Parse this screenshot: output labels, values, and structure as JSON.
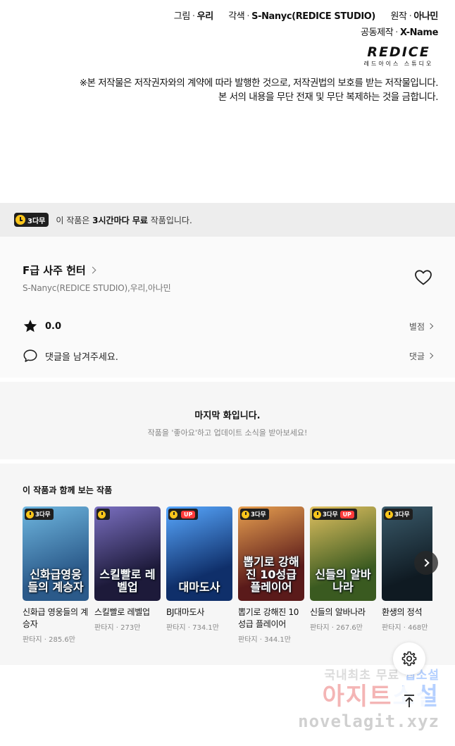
{
  "credits": {
    "art_label": "그림",
    "art_value": "우리",
    "adapt_label": "각색",
    "adapt_value": "S-Nanyc(REDICE STUDIO)",
    "original_label": "원작",
    "original_value": "아나민",
    "co_label": "공동제작",
    "co_value": "X-Name",
    "logo_word": "REDICE",
    "logo_sub": "레드아이스 스튜디오",
    "notice_line1": "※본 저작물은 저작권자와의 계약에 따라 발행한 것으로, 저작권법의 보호를 받는 저작물입니다.",
    "notice_line2": "본 서의 내용을 무단 전재 및 무단 복제하는 것을 금합니다."
  },
  "wait_banner": {
    "badge": "3다무",
    "text_pre": "이 작품은 ",
    "text_bold": "3시간마다 무료",
    "text_post": " 작품입니다."
  },
  "series": {
    "title": "F급 사주 헌터",
    "authors": "S-Nanyc(REDICE STUDIO),우리,아나민",
    "rating": "0.0",
    "rating_link": "별점",
    "comment_prompt": "댓글을 남겨주세요.",
    "comment_link": "댓글"
  },
  "last_episode": {
    "title": "마지막 화입니다.",
    "subtitle": "작품을 '좋아요'하고 업데이트 소식을 받아보세요!"
  },
  "recommendations": {
    "title": "이 작품과 함께 보는 작품",
    "items": [
      {
        "name": "신화급 영웅들의 계승자",
        "meta": "판타지 · 285.6만",
        "badge": "3다무",
        "up": "",
        "cover_text": "신화급영웅들의 계승자",
        "colors": [
          "#2b5a8a",
          "#6fb7e0"
        ]
      },
      {
        "name": "스킬빨로 레벨업",
        "meta": "판타지 · 273만",
        "badge": "",
        "up": "",
        "cover_text": "스킬빨로 레벨업",
        "colors": [
          "#1d1a3a",
          "#7a6fc0"
        ]
      },
      {
        "name": "BJ대마도사",
        "meta": "판타지 · 734.1만",
        "badge": "",
        "up": "UP",
        "cover_text": "대마도사",
        "colors": [
          "#0f2f6a",
          "#58a8ff"
        ]
      },
      {
        "name": "뽑기로 강해진 10성급 플레이어",
        "meta": "판타지 · 344.1만",
        "badge": "3다무",
        "up": "",
        "cover_text": "뽑기로 강해진 10성급 플레이어",
        "colors": [
          "#5a1a1a",
          "#e8a050"
        ]
      },
      {
        "name": "신들의 알바나라",
        "meta": "판타지 · 267.6만",
        "badge": "3다무",
        "up": "UP",
        "cover_text": "신들의 알바나라",
        "colors": [
          "#3a5a20",
          "#e0c060"
        ]
      },
      {
        "name": "환생의 정석",
        "meta": "판타지 · 468만",
        "badge": "3다무",
        "up": "",
        "cover_text": "",
        "colors": [
          "#0f1a22",
          "#3a5a6a"
        ]
      }
    ]
  },
  "watermark": {
    "line1_a": "국내최초 무료 ",
    "line1_b": "웹소설",
    "line2_a": "아지트",
    "line2_b": "소설",
    "line3": "novelagit.xyz"
  }
}
